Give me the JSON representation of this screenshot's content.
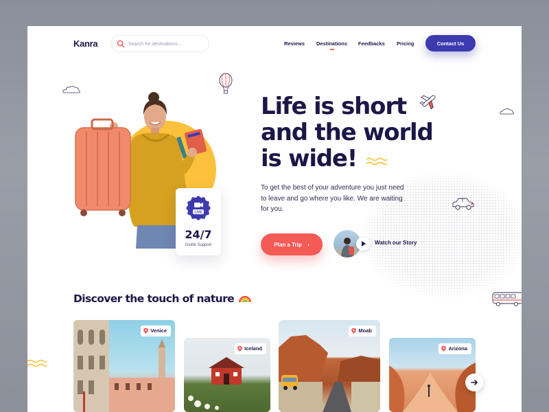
{
  "brand": {
    "name": "Kanra"
  },
  "search": {
    "placeholder": "Search for destinations..."
  },
  "nav": {
    "items": [
      {
        "label": "Reviews",
        "active": false
      },
      {
        "label": "Destinations",
        "active": true
      },
      {
        "label": "Feedbacks",
        "active": false
      },
      {
        "label": "Pricing",
        "active": false
      }
    ],
    "contact_label": "Contact Us"
  },
  "hero": {
    "title_lines": [
      "Life is short",
      "and the world",
      "is wide!"
    ],
    "description": "To get the best of your adventure you just need to leave and go where you like. We are waiting for you.",
    "plan_label": "Plan a Trip",
    "watch_label": "Watch our Story"
  },
  "support": {
    "badge": "LIVE",
    "value": "24/7",
    "label": "Guide Support"
  },
  "discover": {
    "title": "Discover the touch of nature",
    "destinations": [
      {
        "name": "Venice"
      },
      {
        "name": "Iceland"
      },
      {
        "name": "Moab"
      },
      {
        "name": "Arizona"
      }
    ]
  },
  "colors": {
    "brand_dark": "#1c1746",
    "accent_primary": "#3d3ab0",
    "accent_coral": "#f45a56",
    "accent_yellow": "#fcc13c"
  },
  "icons": [
    "search-icon",
    "play-icon",
    "location-pin-icon",
    "arrow-right-icon",
    "chevron-right-icon",
    "video-camera-icon",
    "rainbow-icon",
    "cloud-icon",
    "hot-air-balloon-icon",
    "airplane-icon",
    "car-icon",
    "bus-icon",
    "wave-decoration"
  ]
}
